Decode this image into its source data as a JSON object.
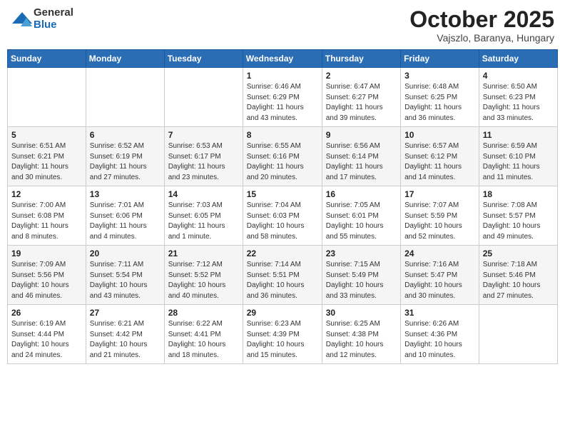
{
  "header": {
    "logo_general": "General",
    "logo_blue": "Blue",
    "month_title": "October 2025",
    "location": "Vajszlo, Baranya, Hungary"
  },
  "weekdays": [
    "Sunday",
    "Monday",
    "Tuesday",
    "Wednesday",
    "Thursday",
    "Friday",
    "Saturday"
  ],
  "weeks": [
    [
      {
        "day": "",
        "info": ""
      },
      {
        "day": "",
        "info": ""
      },
      {
        "day": "",
        "info": ""
      },
      {
        "day": "1",
        "info": "Sunrise: 6:46 AM\nSunset: 6:29 PM\nDaylight: 11 hours\nand 43 minutes."
      },
      {
        "day": "2",
        "info": "Sunrise: 6:47 AM\nSunset: 6:27 PM\nDaylight: 11 hours\nand 39 minutes."
      },
      {
        "day": "3",
        "info": "Sunrise: 6:48 AM\nSunset: 6:25 PM\nDaylight: 11 hours\nand 36 minutes."
      },
      {
        "day": "4",
        "info": "Sunrise: 6:50 AM\nSunset: 6:23 PM\nDaylight: 11 hours\nand 33 minutes."
      }
    ],
    [
      {
        "day": "5",
        "info": "Sunrise: 6:51 AM\nSunset: 6:21 PM\nDaylight: 11 hours\nand 30 minutes."
      },
      {
        "day": "6",
        "info": "Sunrise: 6:52 AM\nSunset: 6:19 PM\nDaylight: 11 hours\nand 27 minutes."
      },
      {
        "day": "7",
        "info": "Sunrise: 6:53 AM\nSunset: 6:17 PM\nDaylight: 11 hours\nand 23 minutes."
      },
      {
        "day": "8",
        "info": "Sunrise: 6:55 AM\nSunset: 6:16 PM\nDaylight: 11 hours\nand 20 minutes."
      },
      {
        "day": "9",
        "info": "Sunrise: 6:56 AM\nSunset: 6:14 PM\nDaylight: 11 hours\nand 17 minutes."
      },
      {
        "day": "10",
        "info": "Sunrise: 6:57 AM\nSunset: 6:12 PM\nDaylight: 11 hours\nand 14 minutes."
      },
      {
        "day": "11",
        "info": "Sunrise: 6:59 AM\nSunset: 6:10 PM\nDaylight: 11 hours\nand 11 minutes."
      }
    ],
    [
      {
        "day": "12",
        "info": "Sunrise: 7:00 AM\nSunset: 6:08 PM\nDaylight: 11 hours\nand 8 minutes."
      },
      {
        "day": "13",
        "info": "Sunrise: 7:01 AM\nSunset: 6:06 PM\nDaylight: 11 hours\nand 4 minutes."
      },
      {
        "day": "14",
        "info": "Sunrise: 7:03 AM\nSunset: 6:05 PM\nDaylight: 11 hours\nand 1 minute."
      },
      {
        "day": "15",
        "info": "Sunrise: 7:04 AM\nSunset: 6:03 PM\nDaylight: 10 hours\nand 58 minutes."
      },
      {
        "day": "16",
        "info": "Sunrise: 7:05 AM\nSunset: 6:01 PM\nDaylight: 10 hours\nand 55 minutes."
      },
      {
        "day": "17",
        "info": "Sunrise: 7:07 AM\nSunset: 5:59 PM\nDaylight: 10 hours\nand 52 minutes."
      },
      {
        "day": "18",
        "info": "Sunrise: 7:08 AM\nSunset: 5:57 PM\nDaylight: 10 hours\nand 49 minutes."
      }
    ],
    [
      {
        "day": "19",
        "info": "Sunrise: 7:09 AM\nSunset: 5:56 PM\nDaylight: 10 hours\nand 46 minutes."
      },
      {
        "day": "20",
        "info": "Sunrise: 7:11 AM\nSunset: 5:54 PM\nDaylight: 10 hours\nand 43 minutes."
      },
      {
        "day": "21",
        "info": "Sunrise: 7:12 AM\nSunset: 5:52 PM\nDaylight: 10 hours\nand 40 minutes."
      },
      {
        "day": "22",
        "info": "Sunrise: 7:14 AM\nSunset: 5:51 PM\nDaylight: 10 hours\nand 36 minutes."
      },
      {
        "day": "23",
        "info": "Sunrise: 7:15 AM\nSunset: 5:49 PM\nDaylight: 10 hours\nand 33 minutes."
      },
      {
        "day": "24",
        "info": "Sunrise: 7:16 AM\nSunset: 5:47 PM\nDaylight: 10 hours\nand 30 minutes."
      },
      {
        "day": "25",
        "info": "Sunrise: 7:18 AM\nSunset: 5:46 PM\nDaylight: 10 hours\nand 27 minutes."
      }
    ],
    [
      {
        "day": "26",
        "info": "Sunrise: 6:19 AM\nSunset: 4:44 PM\nDaylight: 10 hours\nand 24 minutes."
      },
      {
        "day": "27",
        "info": "Sunrise: 6:21 AM\nSunset: 4:42 PM\nDaylight: 10 hours\nand 21 minutes."
      },
      {
        "day": "28",
        "info": "Sunrise: 6:22 AM\nSunset: 4:41 PM\nDaylight: 10 hours\nand 18 minutes."
      },
      {
        "day": "29",
        "info": "Sunrise: 6:23 AM\nSunset: 4:39 PM\nDaylight: 10 hours\nand 15 minutes."
      },
      {
        "day": "30",
        "info": "Sunrise: 6:25 AM\nSunset: 4:38 PM\nDaylight: 10 hours\nand 12 minutes."
      },
      {
        "day": "31",
        "info": "Sunrise: 6:26 AM\nSunset: 4:36 PM\nDaylight: 10 hours\nand 10 minutes."
      },
      {
        "day": "",
        "info": ""
      }
    ]
  ]
}
